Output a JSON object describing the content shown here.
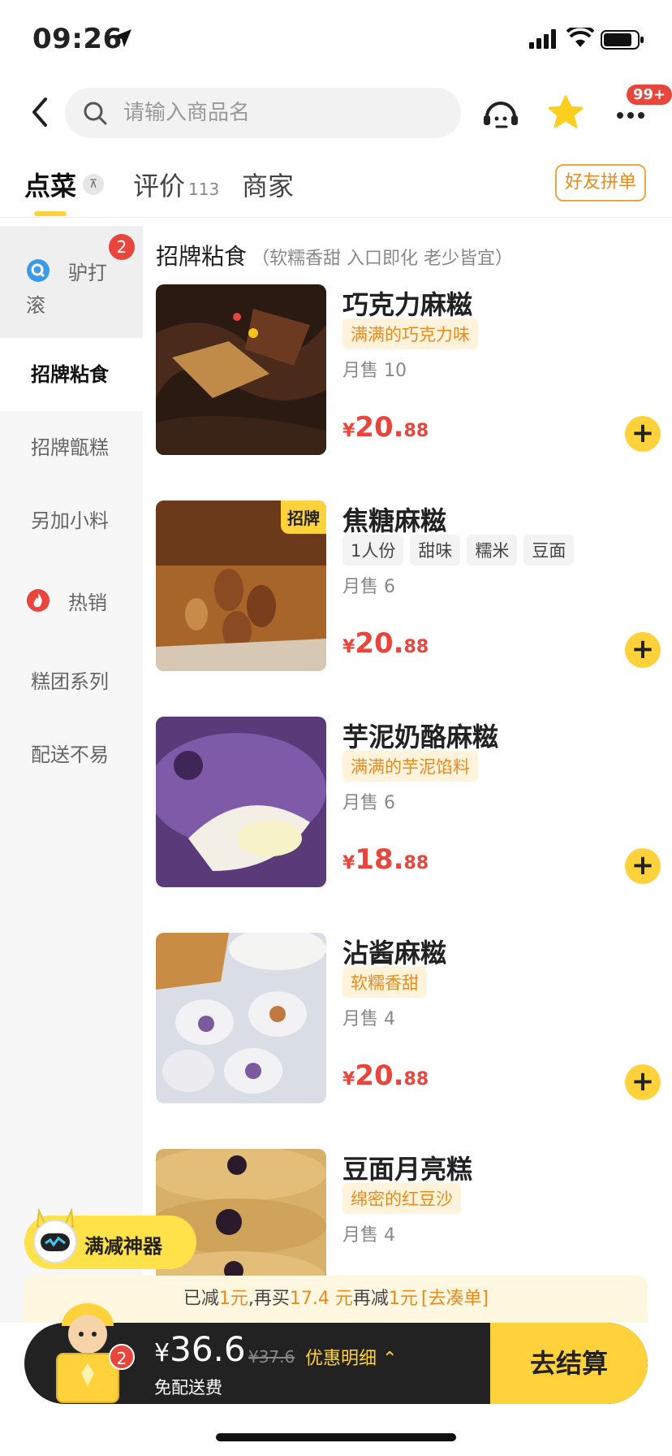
{
  "status_bar": {
    "time": "09:26"
  },
  "header": {
    "search_placeholder": "请输入商品名",
    "more_badge": "99+"
  },
  "tabs": [
    {
      "label": "点菜"
    },
    {
      "label": "评价",
      "count": "113"
    },
    {
      "label": "商家"
    }
  ],
  "friend_order_label": "好友拼单",
  "sidebar": {
    "items": [
      {
        "label": "驴打滚",
        "badge": "2"
      },
      {
        "label": "招牌粘食"
      },
      {
        "label": "招牌甑糕"
      },
      {
        "label": "另加小料"
      },
      {
        "label": "热销"
      },
      {
        "label": "糕团系列"
      },
      {
        "label": "配送不易"
      }
    ]
  },
  "category": {
    "title": "招牌粘食",
    "subtitle": "（软糯香甜 入口即化 老少皆宜）"
  },
  "products": [
    {
      "name": "巧克力麻糍",
      "tag": "满满的巧克力味",
      "sold": "月售 10",
      "price_int": "20.",
      "price_dec": "88",
      "currency": "¥"
    },
    {
      "name": "焦糖麻糍",
      "badge": "招牌",
      "tags": [
        "1人份",
        "甜味",
        "糯米",
        "豆面"
      ],
      "sold": "月售 6",
      "price_int": "20.",
      "price_dec": "88",
      "currency": "¥"
    },
    {
      "name": "芋泥奶酪麻糍",
      "tag": "满满的芋泥馅料",
      "sold": "月售 6",
      "price_int": "18.",
      "price_dec": "88",
      "currency": "¥"
    },
    {
      "name": "沾酱麻糍",
      "tag": "软糯香甜",
      "sold": "月售 4",
      "price_int": "20.",
      "price_dec": "88",
      "currency": "¥"
    },
    {
      "name": "豆面月亮糕",
      "tag": "绵密的红豆沙",
      "sold": "月售 4"
    }
  ],
  "promo": {
    "label": "满减神器"
  },
  "discount": {
    "p1": "已减",
    "v1": "1元",
    "p2": ",再买",
    "v2": "17.4 元",
    "p3": "再减",
    "v3": "1元",
    "v4": "[去凑单]"
  },
  "cart": {
    "currency": "¥",
    "total": "36.6",
    "original": "¥37.6",
    "detail": "优惠明细",
    "delivery": "免配送费",
    "badge": "2",
    "checkout": "去结算"
  },
  "colors": {
    "accent": "#ffd23c",
    "price": "#e8453c",
    "tag_orange": "#e88b1e"
  }
}
